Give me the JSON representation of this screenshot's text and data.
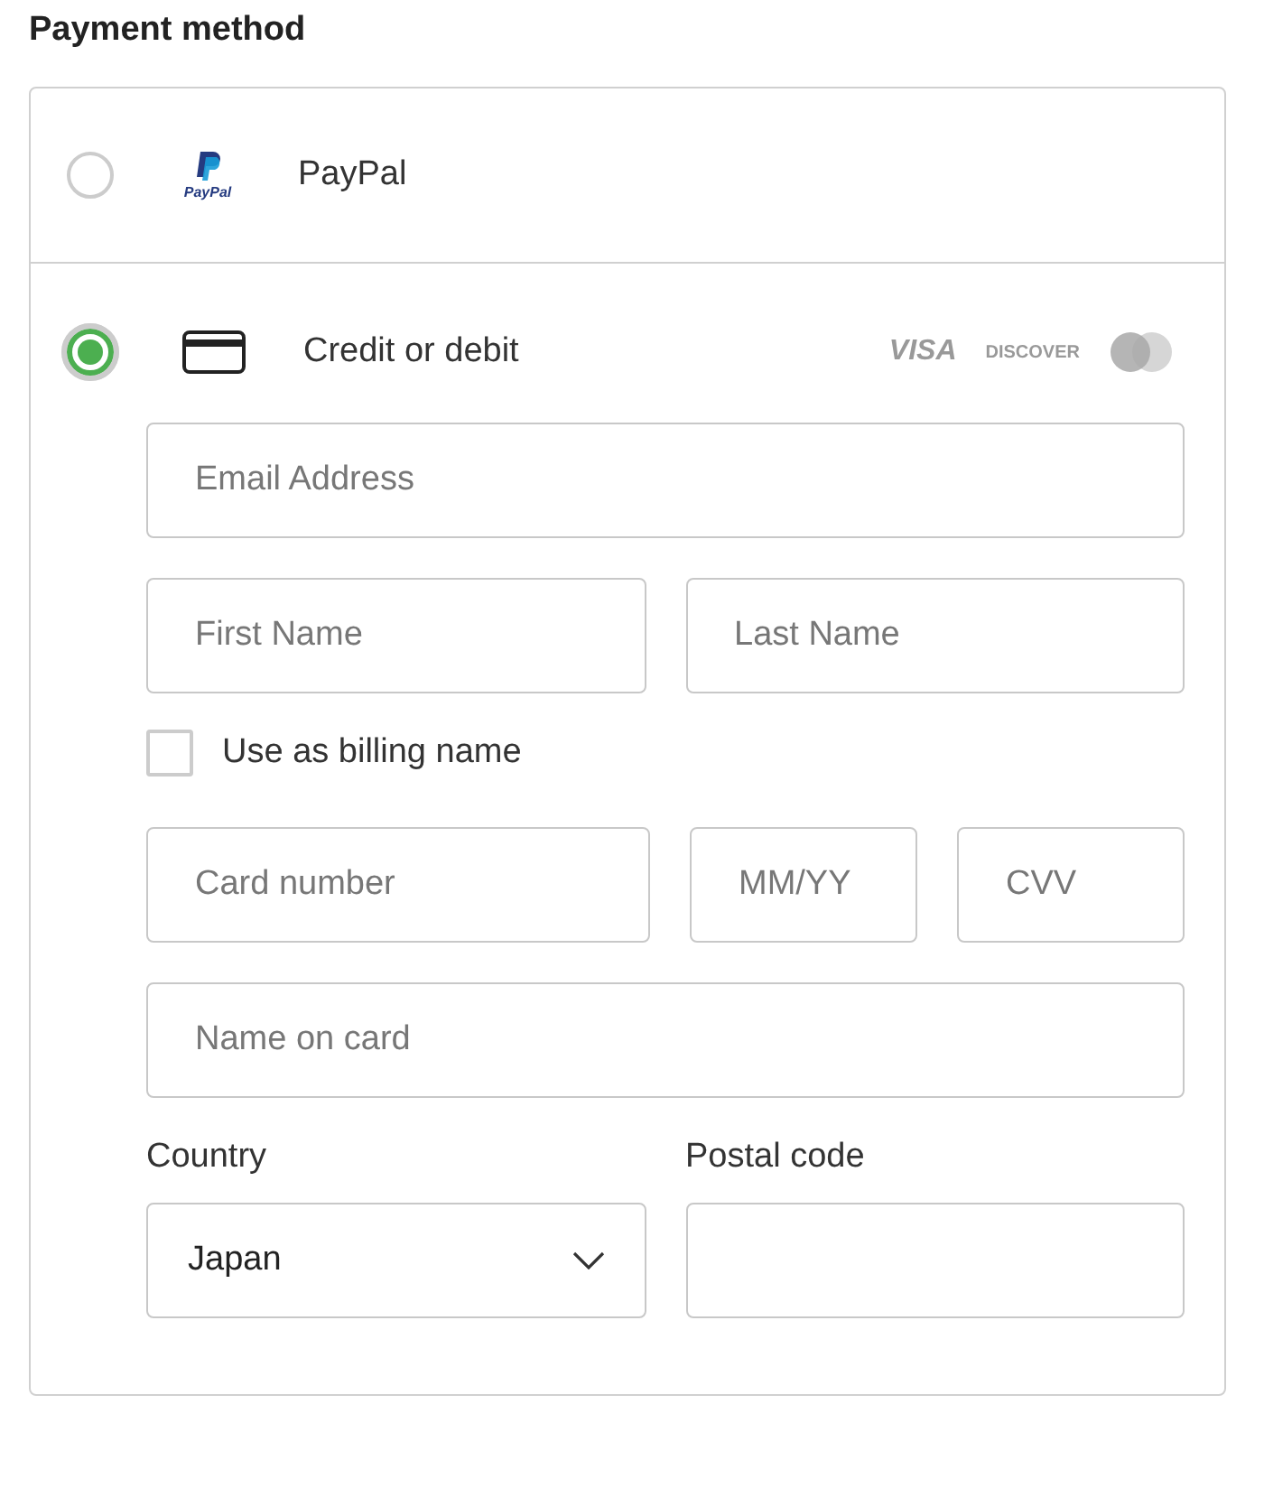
{
  "heading": "Payment method",
  "methods": [
    {
      "kind": "paypal",
      "label": "PayPal",
      "logo_text": "PayPal",
      "selected": false
    },
    {
      "kind": "card",
      "label": "Credit or debit",
      "brands": [
        "VISA",
        "DISCOVER"
      ],
      "selected": true
    }
  ],
  "form": {
    "email": {
      "placeholder": "Email Address"
    },
    "first_name": {
      "placeholder": "First Name"
    },
    "last_name": {
      "placeholder": "Last Name"
    },
    "billing_checkbox": {
      "label": "Use as billing name",
      "checked": false
    },
    "card_number": {
      "placeholder": "Card number"
    },
    "expiry": {
      "placeholder": "MM/YY"
    },
    "cvv": {
      "placeholder": "CVV"
    },
    "name_on_card": {
      "placeholder": "Name on card"
    },
    "country": {
      "label": "Country",
      "value": "Japan"
    },
    "postal_code": {
      "label": "Postal code"
    }
  }
}
